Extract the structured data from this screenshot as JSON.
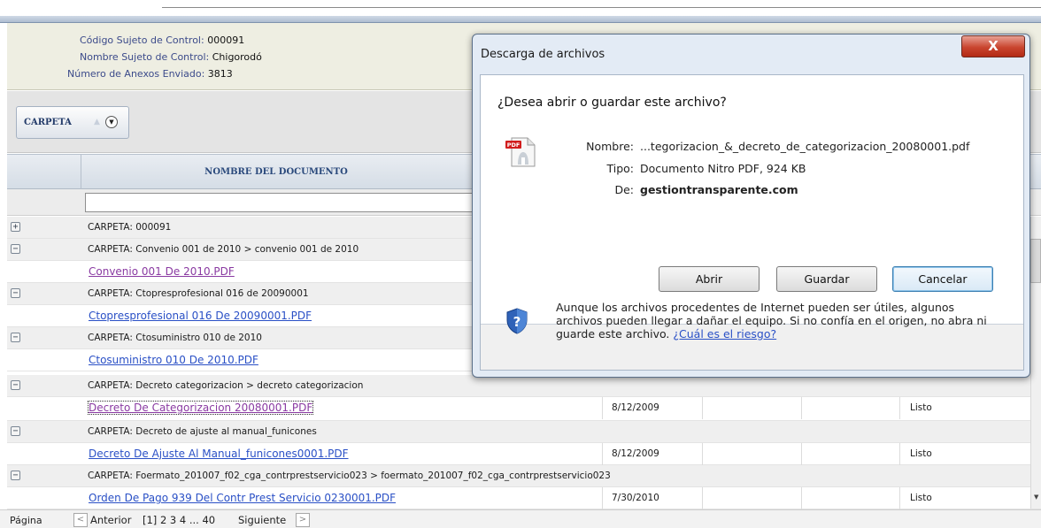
{
  "info": {
    "codigo_label": "Código Sujeto de Control:",
    "codigo_value": "000091",
    "nombre_label": "Nombre Sujeto de Control:",
    "nombre_value": "Chigorodó",
    "anexos_label": "Número de Anexos Enviado:",
    "anexos_value": "3813"
  },
  "carpeta_button": {
    "label": "CARPETA",
    "sort_up_icon": "sort-up-icon",
    "sort_down_icon": "chevron-down-circle-icon"
  },
  "table": {
    "header_nombre": "NOMBRE DEL DOCUMENTO",
    "filter_value": "",
    "rows": [
      {
        "type": "folder",
        "toggle": "+",
        "text": "CARPETA: 000091"
      },
      {
        "type": "folder",
        "toggle": "−",
        "text": "CARPETA: Convenio 001 de 2010 > convenio 001 de 2010"
      },
      {
        "type": "file",
        "text": "Convenio 001 De 2010.PDF",
        "style": "visited"
      },
      {
        "type": "folder",
        "toggle": "−",
        "text": "CARPETA: Ctopresprofesional 016 de 20090001"
      },
      {
        "type": "file",
        "text": "Ctopresprofesional 016 De 20090001.PDF",
        "style": "unvisited"
      },
      {
        "type": "folder",
        "toggle": "−",
        "text": "CARPETA: Ctosuministro 010 de 2010"
      },
      {
        "type": "file",
        "text": "Ctosuministro 010 De 2010.PDF",
        "style": "unvisited"
      },
      {
        "type": "folder",
        "toggle": "−",
        "text": "CARPETA: Decreto categorizacion > decreto categorizacion"
      },
      {
        "type": "file",
        "text": "Decreto De Categorizacion 20080001.PDF",
        "style": "visited",
        "date": "8/12/2009",
        "status": "Listo"
      },
      {
        "type": "folder",
        "toggle": "−",
        "text": "CARPETA: Decreto de ajuste al manual_funicones"
      },
      {
        "type": "file",
        "text": "Decreto De Ajuste Al Manual_funicones0001.PDF",
        "style": "unvisited",
        "date": "8/12/2009",
        "status": "Listo"
      },
      {
        "type": "folder",
        "toggle": "−",
        "text": "CARPETA: Foermato_201007_f02_cga_contrprestservicio023 > foermato_201007_f02_cga_contrprestservicio023"
      },
      {
        "type": "file",
        "text": "Orden De Pago 939 Del Contr Prest Servicio 0230001.PDF",
        "style": "unvisited",
        "date": "7/30/2010",
        "status": "Listo"
      }
    ]
  },
  "pager": {
    "label": "Página",
    "prev": "Anterior",
    "pages": "[1] 2 3 4 ... 40",
    "next": "Siguiente",
    "prev_icon": "<",
    "next_icon": ">"
  },
  "dialog": {
    "title": "Descarga de archivos",
    "close_icon": "X",
    "question": "¿Desea abrir o guardar este archivo?",
    "nombre_key": "Nombre:",
    "nombre_val": "...tegorizacion_&_decreto_de_categorizacion_20080001.pdf",
    "tipo_key": "Tipo:",
    "tipo_val": "Documento Nitro PDF, 924 KB",
    "de_key": "De:",
    "de_val": "gestiontransparente.com",
    "btn_abrir": "Abrir",
    "btn_guardar": "Guardar",
    "btn_cancelar": "Cancelar",
    "warning_text": "Aunque los archivos procedentes de Internet pueden ser útiles, algunos archivos pueden llegar a dañar el equipo. Si no confía en el origen, no abra ni guarde este archivo.",
    "warning_link": "¿Cuál es el riesgo?",
    "pdf_icon_text": "PDF"
  },
  "colors": {
    "link_visited": "#8a3aa2",
    "link_unvisited": "#2a50c6",
    "close_button": "#c9452f",
    "dialog_frame": "#e3ebf5"
  }
}
